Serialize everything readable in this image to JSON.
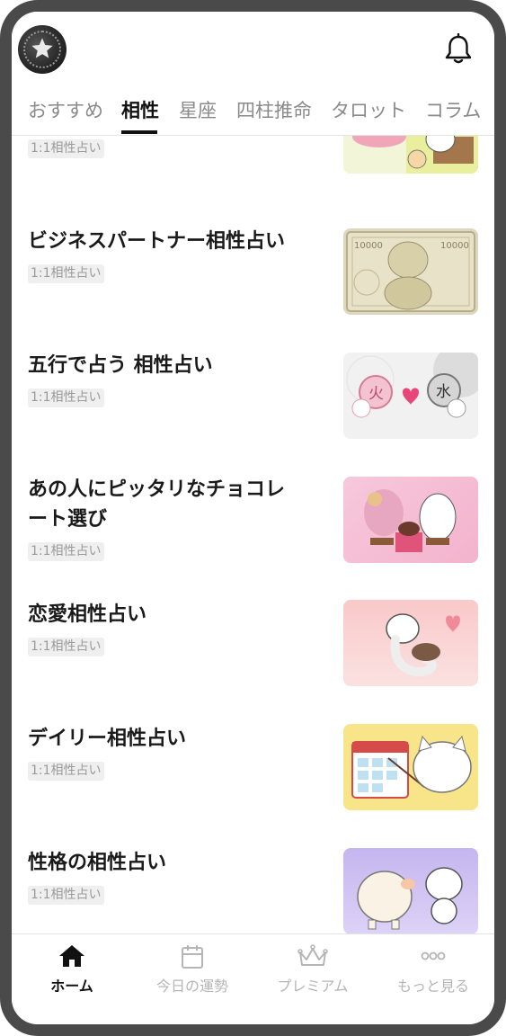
{
  "header": {
    "avatar_icon": "star-avatar-icon",
    "bell_icon": "bell-icon"
  },
  "tabs": [
    {
      "label": "おすすめ",
      "active": false
    },
    {
      "label": "相性",
      "active": true
    },
    {
      "label": "星座",
      "active": false
    },
    {
      "label": "四柱推命",
      "active": false
    },
    {
      "label": "タロット",
      "active": false
    },
    {
      "label": "コラム",
      "active": false
    }
  ],
  "items": [
    {
      "title": "",
      "badge": "1:1相性占い"
    },
    {
      "title": "ビジネスパートナー相性占い",
      "badge": "1:1相性占い"
    },
    {
      "title": "五行で占う 相性占い",
      "badge": "1:1相性占い"
    },
    {
      "title_line1": "あの人にピッタリなチョコレ",
      "title_line2": "ート選び",
      "badge": "1:1相性占い"
    },
    {
      "title": "恋愛相性占い",
      "badge": "1:1相性占い"
    },
    {
      "title": "デイリー相性占い",
      "badge": "1:1相性占い"
    },
    {
      "title": "性格の相性占い",
      "badge": "1:1相性占い"
    }
  ],
  "thumb_text": {
    "fire": "火",
    "water": "水",
    "bill_left": "10000",
    "bill_right": "10000"
  },
  "bottom_nav": [
    {
      "label": "ホーム",
      "icon": "home-icon",
      "active": true
    },
    {
      "label": "今日の運勢",
      "icon": "calendar-icon",
      "active": false
    },
    {
      "label": "プレミアム",
      "icon": "crown-icon",
      "active": false
    },
    {
      "label": "もっと見る",
      "icon": "more-icon",
      "active": false
    }
  ],
  "colors": {
    "frame": "#4a4a4a",
    "text": "#1a1a1a",
    "muted": "#8a8a8a",
    "heart": "#e8457a"
  }
}
